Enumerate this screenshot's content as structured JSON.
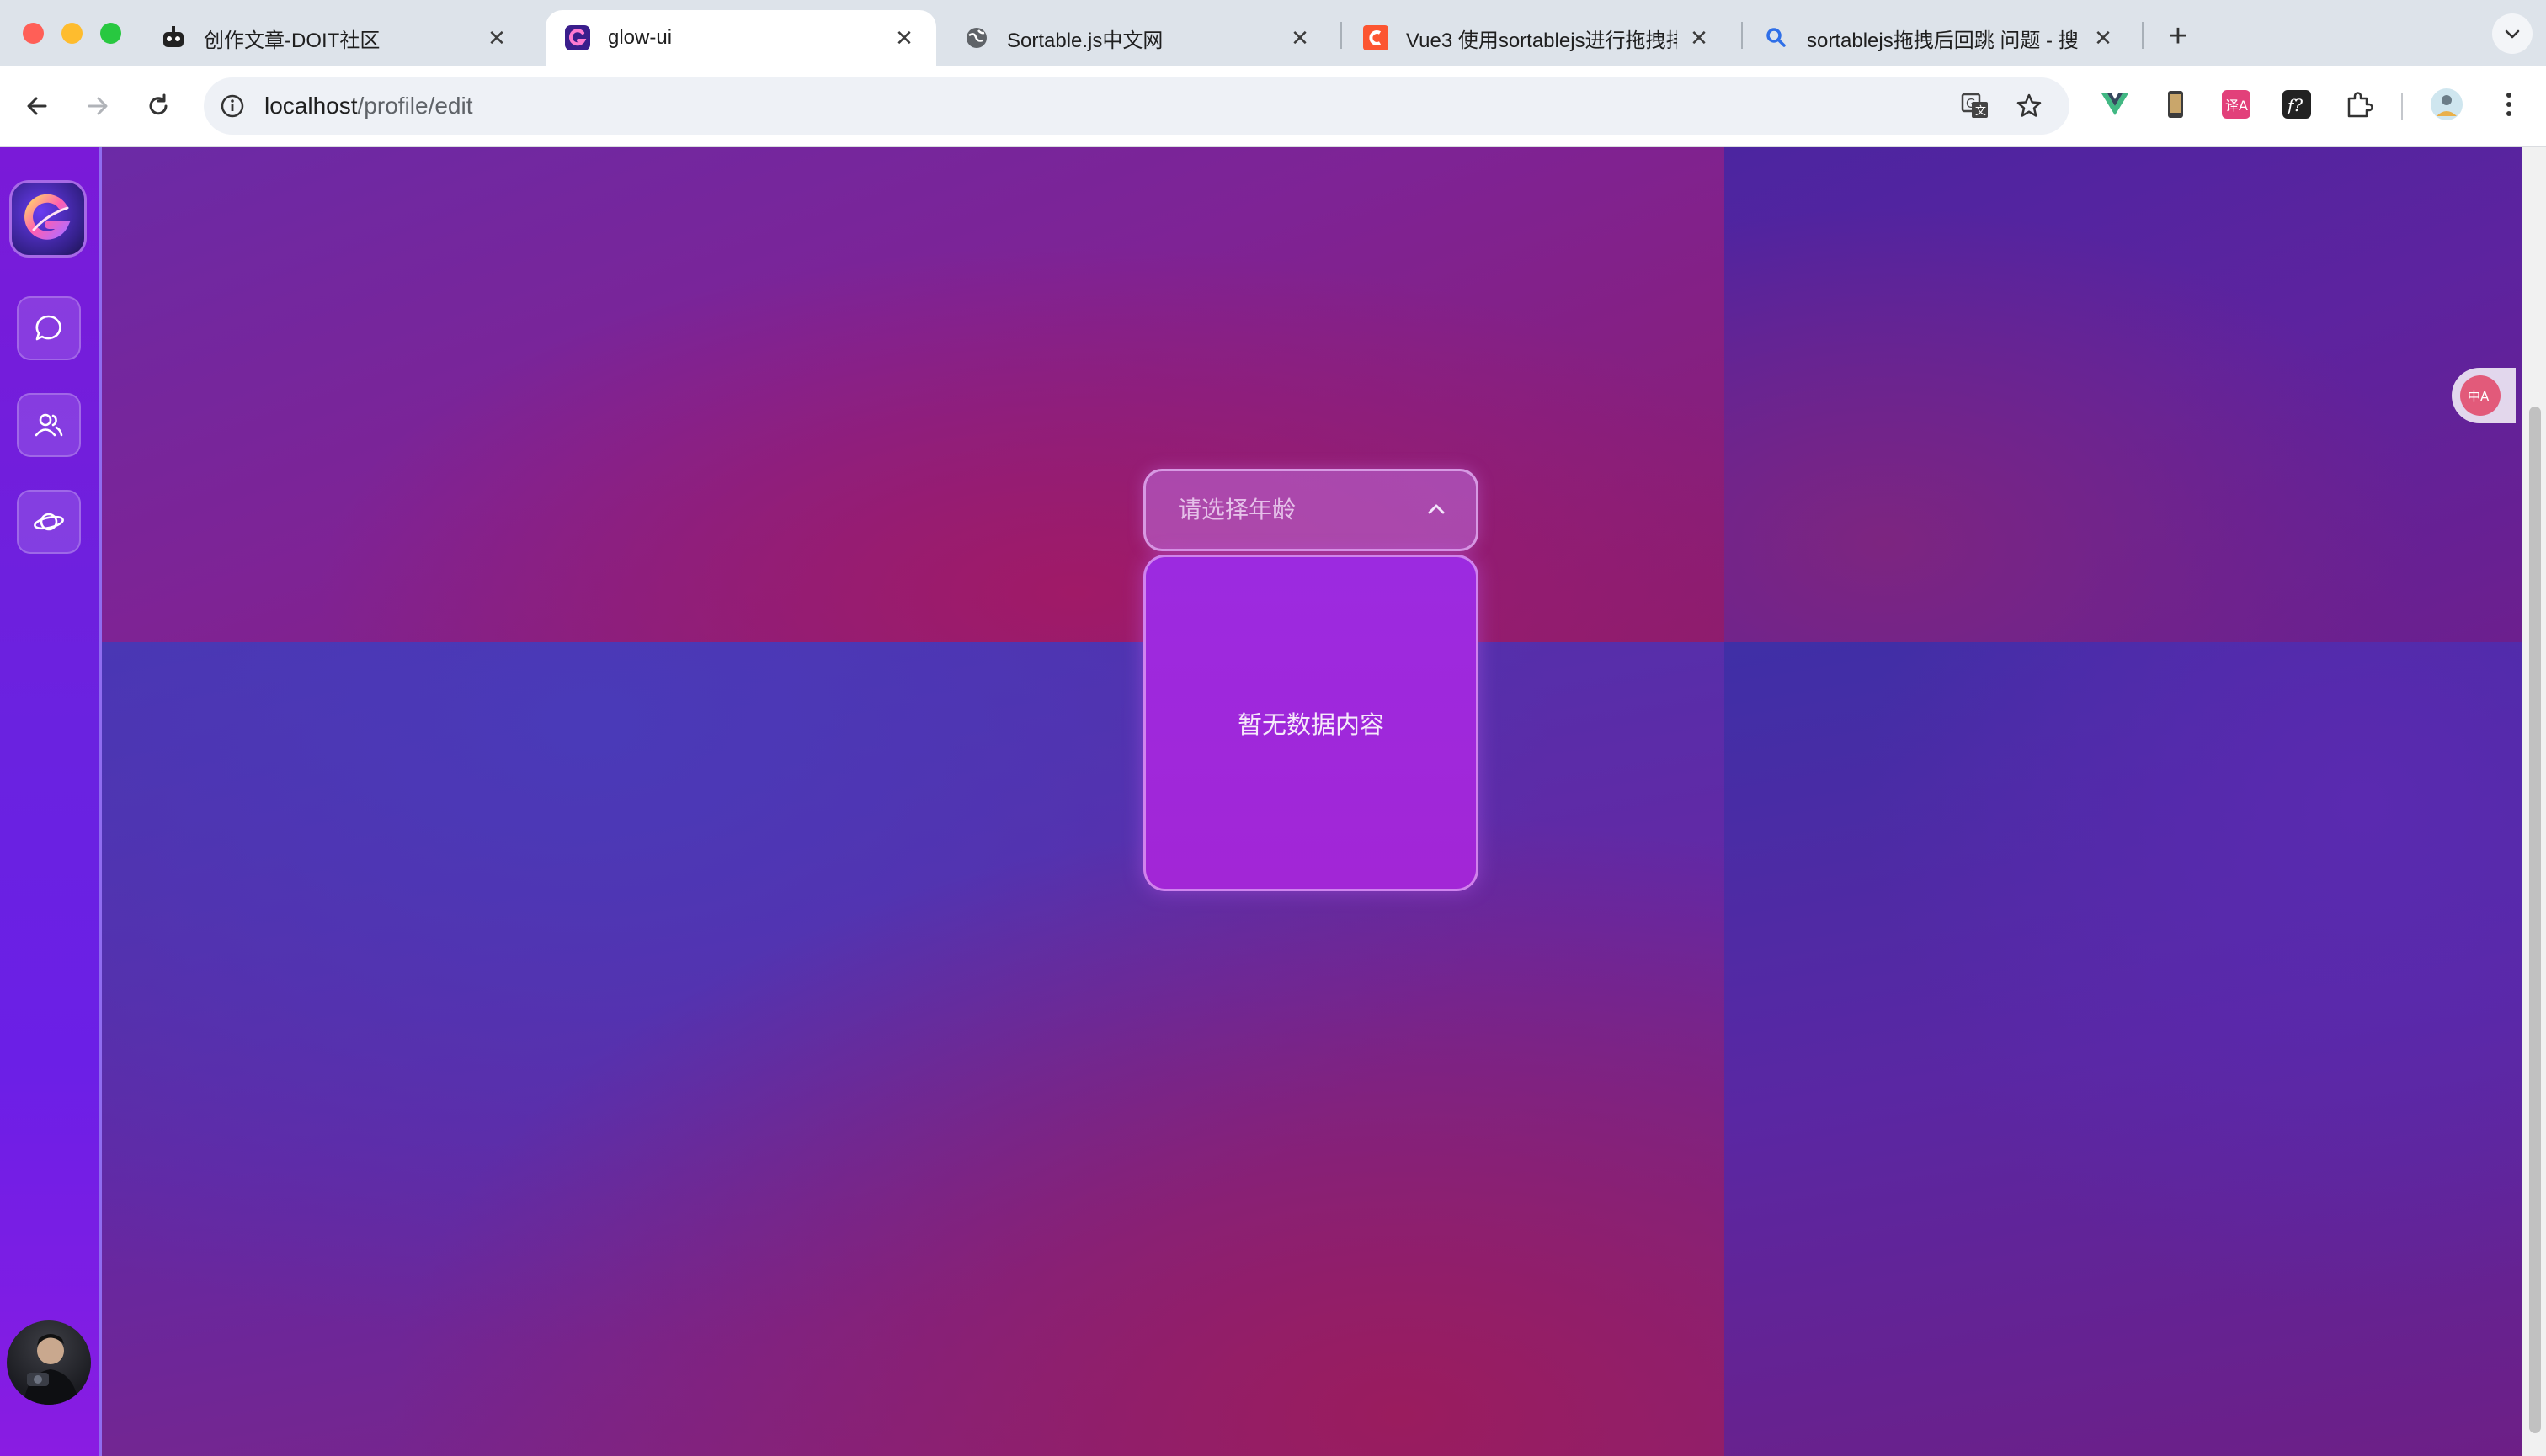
{
  "browser": {
    "tabs": [
      {
        "title": "创作文章-DOIT社区",
        "favicon": "robot-icon",
        "active": false
      },
      {
        "title": "glow-ui",
        "favicon": "glow-logo-icon",
        "active": true
      },
      {
        "title": "Sortable.js中文网",
        "favicon": "globe-icon",
        "active": false
      },
      {
        "title": "Vue3 使用sortablejs进行拖拽排",
        "favicon": "csdn-c-icon",
        "active": false
      },
      {
        "title": "sortablejs拖拽后回跳 问题 - 搜",
        "favicon": "search-icon",
        "active": false
      }
    ],
    "new_tab_label": "+",
    "close_glyph": "✕",
    "url": {
      "host": "localhost",
      "path": "/profile/edit"
    },
    "colors": {
      "tabstrip": "#dde3ea",
      "toolbar": "#ffffff",
      "omnibox": "#eef1f6"
    }
  },
  "app": {
    "sidebar": {
      "logo_glyph": "G",
      "nav_items": [
        {
          "icon": "chat-bubble-icon"
        },
        {
          "icon": "users-icon"
        },
        {
          "icon": "planet-icon"
        }
      ],
      "avatar": "avatar-icon"
    },
    "select": {
      "placeholder": "请选择年龄",
      "expanded": true,
      "empty_text": "暂无数据内容"
    },
    "colors": {
      "sidebar_top": "#7a1ad8",
      "sidebar_bottom": "#8a1ce2",
      "dropdown": "#a226d6",
      "translate_badge": "#e25a7a"
    }
  }
}
